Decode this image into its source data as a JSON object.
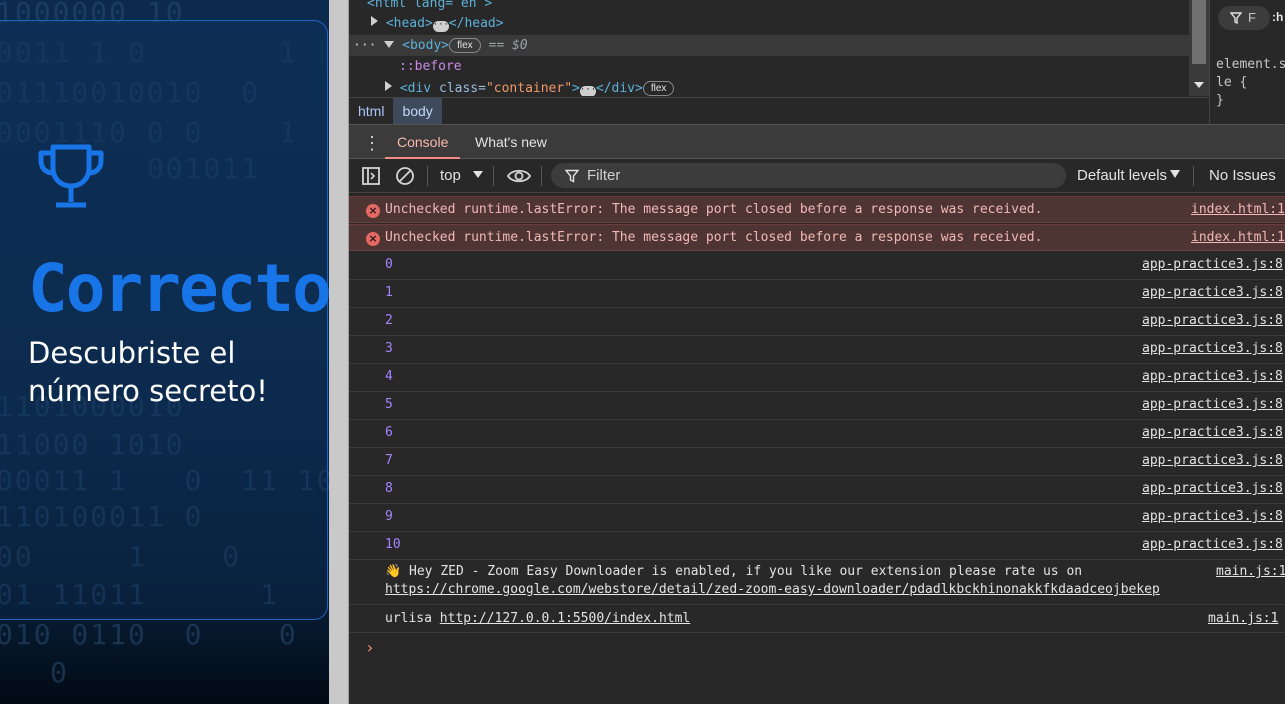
{
  "page": {
    "heading": "Correcto",
    "subtitle": "Descubriste el número secreto!",
    "accent_color": "#1875e8",
    "trophy_icon": "trophy-icon"
  },
  "elements_panel": {
    "line0": {
      "text": "<html lang= en >"
    },
    "line1": {
      "open": "<head>",
      "close": "</head>"
    },
    "line2": {
      "dots": "···",
      "tag": "<body>",
      "pill": "flex",
      "eq": "== $0"
    },
    "line3": {
      "text": "::before"
    },
    "line4": {
      "tag_open": "<div ",
      "attr": "class=",
      "attrval": "\"container\"",
      "tag_close": ">",
      "end": "</div>",
      "pill": "flex"
    }
  },
  "styles_panel": {
    "hov": ":h",
    "code": "element.s\nle {\n}"
  },
  "breadcrumb": [
    "html",
    "body"
  ],
  "drawer_tabs": {
    "console": "Console",
    "whats_new": "What's new"
  },
  "toolbar": {
    "context": "top",
    "filter_placeholder": "Filter",
    "levels": "Default levels",
    "issues": "No Issues"
  },
  "console": {
    "errors": [
      {
        "text": "Unchecked runtime.lastError: The message port closed before a response was received.",
        "source": "index.html:1"
      },
      {
        "text": "Unchecked runtime.lastError: The message port closed before a response was received.",
        "source": "index.html:1"
      }
    ],
    "logs": [
      "0",
      "1",
      "2",
      "3",
      "4",
      "5",
      "6",
      "7",
      "8",
      "9",
      "10"
    ],
    "log_source": "app-practice3.js:8",
    "extension": {
      "line1": "👋 Hey ZED - Zoom Easy Downloader is enabled, if you like our extension please rate us on",
      "url": "https://chrome.google.com/webstore/detail/zed-zoom-easy-downloader/pdadlkbckhinonakkfkdaadceojbekep",
      "source": "main.js:1"
    },
    "urlisa": {
      "label": "urlisa",
      "url": "http://127.0.0.1:5500/index.html",
      "source": "main.js:1"
    },
    "prompt": "›"
  }
}
